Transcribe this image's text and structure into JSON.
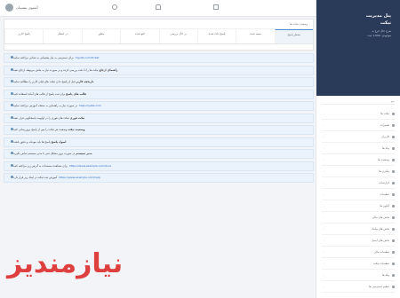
{
  "header": {
    "user_name": "آشنوی پشتیبان"
  },
  "sidebar": {
    "title_line1": "پنل مدیریت",
    "title_line2": "تیکت",
    "sub1": "شرح حال خرج بد",
    "sub2": "موجودی: 1,000 ثبت",
    "menu_heading": "منو",
    "items": [
      "تیکت ها",
      "تعمیرات",
      "کاربران",
      "پیام ها",
      "وضعیت ها",
      "پیگیری ها",
      "گزارشات",
      "تنظیمات",
      "آیکون ها",
      "بخش های مالی",
      "بخش های پیامک",
      "بخش های ایمیل",
      "تنظیمات مالی",
      "تنظیمات تیکت",
      "پیام ها",
      "تنظیم دسترسی ها"
    ]
  },
  "panel": {
    "title": "وضعیت تیکت ها",
    "tabs": [
      "منتظر پاسخ",
      "بسته شده",
      "پاسخ داده شده",
      "در حال بررسی",
      "لغو شده",
      "معلق",
      "در انتظار",
      "پاسخ کاربر"
    ]
  },
  "notes": [
    {
      "text": "برای دسترسی به پنل پشتیبانی به نشانی مراجعه نمایید",
      "link": "mysite.com/ticket",
      "bold": ""
    },
    {
      "text": "تیکت ها را با دقت بررسی کرده و در صورت نیاز به بخش مربوطه ارجاع دهید",
      "link": "",
      "bold": "راهنمای ارجاع"
    },
    {
      "text": "قبل از پاسخ دادن تیکت های قبلی کاربر را مطالعه نمایید",
      "link": "",
      "bold": "تاریخچه کاربر"
    },
    {
      "text": "برای ثبت پاسخ از قالب های آماده استفاده کنید",
      "link": "",
      "bold": "قالب های پاسخ"
    },
    {
      "text": "در صورت نیاز به راهنمایی به صفحه آموزش مراجعه نمایید",
      "link": "help.mysite.com",
      "bold": ""
    },
    {
      "text": "تیکت های فوری را در اولویت پاسخگویی قرار دهید",
      "link": "",
      "bold": "تیکت فوری"
    },
    {
      "text": "وضعیت هر تیکت را پس از پاسخ بروزرسانی کنید",
      "link": "",
      "bold": "وضعیت تیکت"
    },
    {
      "text": "پاسخ ها باید مودبانه و دقیق باشند",
      "link": "",
      "bold": "اصول پاسخ"
    },
    {
      "text": "در صورت بروز مشکل فنی با مدیر سیستم تماس بگیرید",
      "link": "",
      "bold": "مدیر سیستم"
    },
    {
      "text": "برای مشاهده مستندات به آدرس زیر مراجعه کنید",
      "link": "https://www.example.com/docs",
      "bold": ""
    },
    {
      "text": "آموزش ثبت تیکت در لینک زیر قرار دارد",
      "link": "https://www.example.com/help",
      "bold": ""
    }
  ],
  "watermark": "نیازمندیز"
}
